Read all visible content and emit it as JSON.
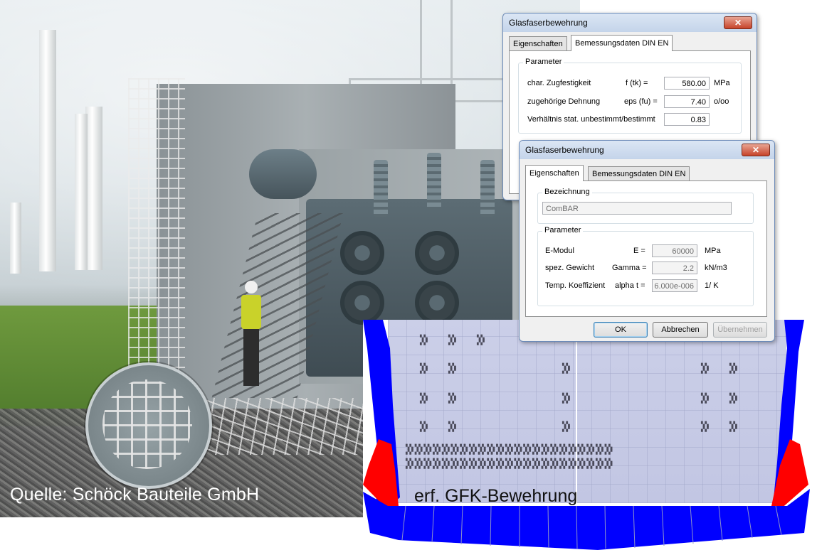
{
  "photo": {
    "caption": "Quelle: Schöck Bauteile GmbH"
  },
  "plot": {
    "caption": "erf. GFK-Bewehrung",
    "colors": {
      "positive": "#0000ff",
      "negative": "#ff0000",
      "mesh": "#c4c8e4"
    }
  },
  "dialog_back": {
    "title": "Glasfaserbewehrung",
    "close_glyph": "✕",
    "tabs": [
      "Eigenschaften",
      "Bemessungsdaten DIN EN"
    ],
    "group_label": "Parameter",
    "rows": [
      {
        "label": "char. Zugfestigkeit",
        "symbol": "f (tk) =",
        "value": "580.00",
        "unit": "MPa"
      },
      {
        "label": "zugehörige Dehnung",
        "symbol": "eps (fu) =",
        "value": "7.40",
        "unit": "o/oo"
      },
      {
        "label": "Verhältnis stat. unbestimmt/bestimmt",
        "symbol": "",
        "value": "0.83",
        "unit": ""
      }
    ]
  },
  "dialog_front": {
    "title": "Glasfaserbewehrung",
    "close_glyph": "✕",
    "tabs": [
      "Eigenschaften",
      "Bemessungsdaten DIN EN"
    ],
    "name_group": "Bezeichnung",
    "name_value": "ComBAR",
    "param_group": "Parameter",
    "rows": [
      {
        "label": "E-Modul",
        "symbol": "E =",
        "value": "60000",
        "unit": "MPa"
      },
      {
        "label": "spez. Gewicht",
        "symbol": "Gamma =",
        "value": "2.2",
        "unit": "kN/m3"
      },
      {
        "label": "Temp. Koeffizient",
        "symbol": "alpha t =",
        "value": "6.000e-006",
        "unit": "1/ K"
      }
    ],
    "buttons": {
      "ok": "OK",
      "cancel": "Abbrechen",
      "apply": "Übernehmen"
    }
  }
}
